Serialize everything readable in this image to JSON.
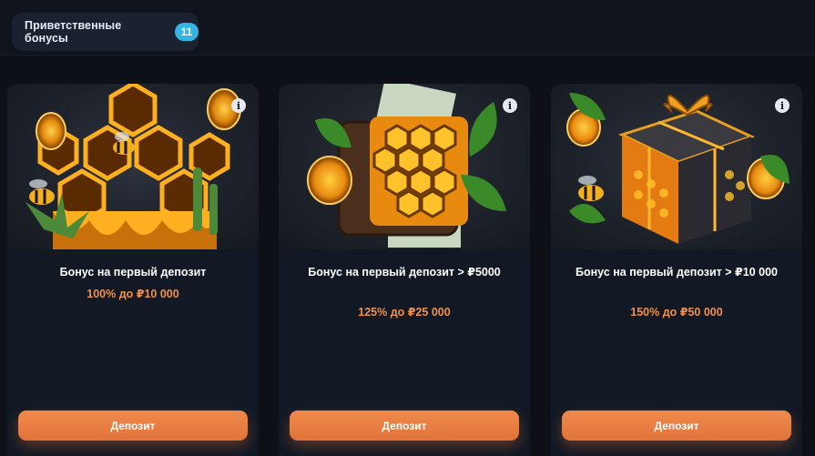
{
  "header": {
    "section_label": "Приветственные бонусы",
    "section_count": "11"
  },
  "cards": [
    {
      "title": "Бонус на первый депозит",
      "amount": "100% до ₽10 000",
      "button_label": "Депозит",
      "info_icon": "i",
      "art": "honeycomb-bees-icon"
    },
    {
      "title": "Бонус на первый депозит > ₽5000",
      "amount": "125% до ₽25 000",
      "button_label": "Депозит",
      "info_icon": "i",
      "art": "wallet-honeycomb-icon"
    },
    {
      "title": "Бонус на первый депозит > ₽10 000",
      "amount": "150% до ₽50 000",
      "button_label": "Депозит",
      "info_icon": "i",
      "art": "gift-box-honeycomb-icon"
    }
  ],
  "colors": {
    "accent": "#f0914a",
    "badge": "#33b6e6",
    "card_bg": "#121925",
    "page_bg": "#0d1117"
  }
}
